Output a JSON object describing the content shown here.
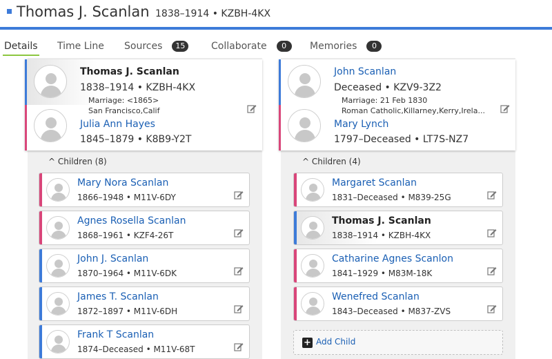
{
  "header": {
    "name": "Thomas J. Scanlan",
    "meta": "1838–1914 • KZBH-4KX"
  },
  "tabs": [
    {
      "label": "Details",
      "badge": null
    },
    {
      "label": "Time Line",
      "badge": null
    },
    {
      "label": "Sources",
      "badge": "15"
    },
    {
      "label": "Collaborate",
      "badge": "0"
    },
    {
      "label": "Memories",
      "badge": "0"
    }
  ],
  "families": [
    {
      "husband": {
        "name": "Thomas J. Scanlan",
        "meta": "1838–1914 •  KZBH-4KX"
      },
      "marriage": [
        "Marriage: <1865>",
        "San Francisco,Calif"
      ],
      "wife": {
        "name": "Julia Ann Hayes",
        "meta": "1845–1879 •  K8B9-Y2T"
      },
      "children_label": "Children (8)",
      "children": [
        {
          "name": "Mary Nora Scanlan",
          "meta": "1866–1948 •  M11V-6DY"
        },
        {
          "name": "Agnes Rosella Scanlan",
          "meta": "1868–1961 •  KZF4-26T"
        },
        {
          "name": "John J. Scanlan",
          "meta": "1870–1964 •  M11V-6DK"
        },
        {
          "name": "James T. Scanlan",
          "meta": "1872–1897 •  M11V-6DH"
        },
        {
          "name": "Frank T Scanlan",
          "meta": "1874–Deceased •  M11V-68T"
        }
      ]
    },
    {
      "husband": {
        "name": "John Scanlan",
        "meta": "Deceased •  KZV9-3Z2"
      },
      "marriage": [
        "Marriage: 21 Feb 1830",
        "Roman Catholic,Killarney,Kerry,Irela..."
      ],
      "wife": {
        "name": "Mary Lynch",
        "meta": "1797–Deceased •  LT7S-NZ7"
      },
      "children_label": "Children (4)",
      "children": [
        {
          "name": "Margaret Scanlan",
          "meta": "1831–Deceased •  M839-25G"
        },
        {
          "name": "Thomas J. Scanlan",
          "meta": "1838–1914 •  KZBH-4KX"
        },
        {
          "name": "Catharine Agnes Scanlon",
          "meta": "1841–1929 •  M83M-18K"
        },
        {
          "name": "Wenefred Scanlan",
          "meta": "1843–Deceased •  M837-ZVS"
        }
      ],
      "add_child_label": "Add Child"
    }
  ],
  "icons": {
    "edit": "pencil-edit-icon",
    "collapse": "chevron-up-icon",
    "add": "plus-icon",
    "avatar": "person-silhouette-icon"
  },
  "colors": {
    "accent": "#3d7bd9",
    "male": "#3d7bd9",
    "female": "#d9467a",
    "active_tab": "#8cc63f",
    "link": "#1a5fb4"
  }
}
